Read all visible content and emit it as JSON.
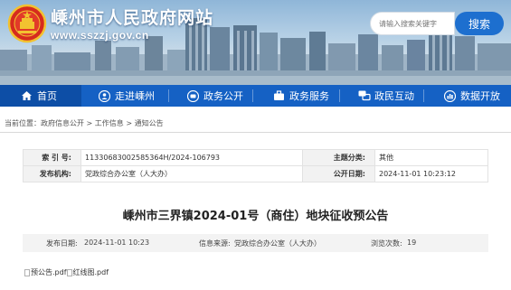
{
  "header": {
    "site_title": "嵊州市人民政府网站",
    "site_url": "www.sszzj.gov.cn",
    "search_placeholder": "请输入搜索关键字",
    "search_button": "搜索"
  },
  "nav": {
    "items": [
      {
        "label": "首页",
        "icon": "home-icon"
      },
      {
        "label": "走进嵊州",
        "icon": "person-icon"
      },
      {
        "label": "政务公开",
        "icon": "chat-icon"
      },
      {
        "label": "政务服务",
        "icon": "briefcase-icon"
      },
      {
        "label": "政民互动",
        "icon": "chat-bubbles-icon"
      },
      {
        "label": "数据开放",
        "icon": "data-icon"
      }
    ]
  },
  "breadcrumb": {
    "prefix": "当前位置：",
    "items": [
      "政府信息公开",
      "工作信息",
      "通知公告"
    ],
    "separator": ">"
  },
  "info": {
    "index_label": "索 引 号:",
    "index_value": "11330683002585364H/2024-106793",
    "category_label": "主题分类:",
    "category_value": "其他",
    "org_label": "发布机构:",
    "org_value": "党政综合办公室（人大办）",
    "date_label": "公开日期:",
    "date_value": "2024-11-01 10:23:12"
  },
  "article": {
    "title": "嵊州市三界镇2024-01号（商住）地块征收预公告",
    "published_label": "发布日期:",
    "published_value": "2024-11-01 10:23",
    "source_label": "信息来源:",
    "source_value": "党政综合办公室（人大办）",
    "views_label": "浏览次数:",
    "views_value": "19",
    "attachments": [
      "预公告.pdf",
      "红线图.pdf"
    ]
  }
}
